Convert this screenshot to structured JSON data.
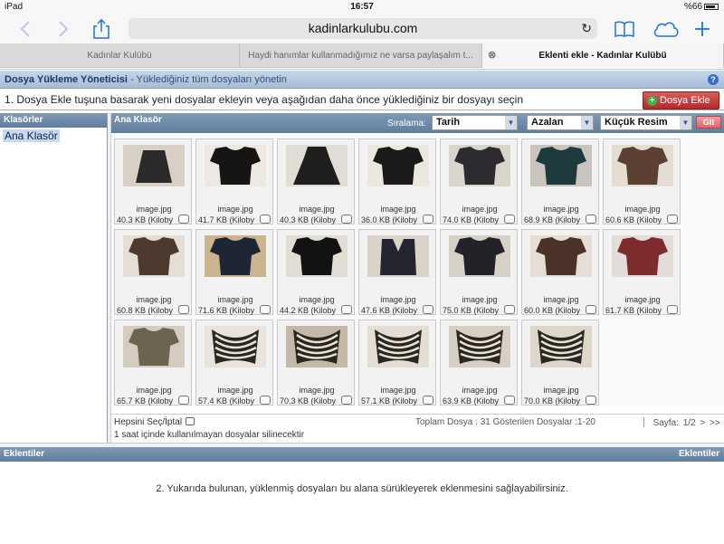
{
  "status": {
    "device": "iPad",
    "time": "16:57",
    "battery": "%66"
  },
  "browser": {
    "url": "kadinlarkulubu.com",
    "tabs": [
      {
        "label": "Kadınlar Kulübü"
      },
      {
        "label": "Haydi hanımlar kullanmadığımız ne varsa paylaşalım t..."
      },
      {
        "label": "Eklenti ekle - Kadınlar Kulübü"
      }
    ]
  },
  "manager": {
    "title": "Dosya Yükleme Yöneticisi",
    "subtitle": "- Yüklediğiniz tüm dosyaları yönetin",
    "help_icon": "?",
    "instruction": "1. Dosya Ekle tuşuna basarak yeni dosyalar ekleyin veya aşağıdan daha önce yüklediğiniz bir dosyayı seçin",
    "add_button": "Dosya Ekle",
    "folders_header": "Klasörler",
    "folder_item": "Ana Klasör",
    "main_header": "Ana Klasör",
    "sort_label": "Sıralama:",
    "sort_field": "Tarih",
    "sort_order": "Azalan",
    "view_mode": "Küçük Resim",
    "go_button": "Git",
    "select_all": "Hepsini Seç/İptal",
    "totals": "Toplam Dosya : 31 Gösterilen Dosyalar :1-20",
    "page": "Sayfa: 1/2",
    "next1": ">",
    "next2": ">>",
    "notice": "1 saat içinde kullanılmayan dosyalar silinecektir",
    "attachments_header": "Eklentiler",
    "attachments_header_right": "Eklentiler",
    "drop_hint": "2. Yukarıda bulunan, yüklenmiş dosyaları bu alana sürükleyerek eklenmesini sağlayabilirsiniz."
  },
  "files": [
    {
      "name": "image.jpg",
      "size": "40.3 KB (Kiloby",
      "color": "#2a2a2a",
      "bg": "#d8d0c4",
      "shape": "skirt"
    },
    {
      "name": "image.jpg",
      "size": "41.7 KB (Kiloby",
      "color": "#151515",
      "bg": "#ede8e2",
      "shape": "top"
    },
    {
      "name": "image.jpg",
      "size": "40.3 KB (Kiloby",
      "color": "#1e1e1e",
      "bg": "#e2ddd4",
      "shape": "dress"
    },
    {
      "name": "image.jpg",
      "size": "36.0 KB (Kiloby",
      "color": "#1a1a1a",
      "bg": "#ece8e0",
      "shape": "top"
    },
    {
      "name": "image.jpg",
      "size": "74.0 KB (Kiloby",
      "color": "#2b2b30",
      "bg": "#d9d4cc",
      "shape": "top"
    },
    {
      "name": "image.jpg",
      "size": "68.9 KB (Kiloby",
      "color": "#1f3a3c",
      "bg": "#c9c5be",
      "shape": "top"
    },
    {
      "name": "image.jpg",
      "size": "60.6 KB (Kiloby",
      "color": "#5b4033",
      "bg": "#e5ddd2",
      "shape": "top"
    },
    {
      "name": "image.jpg",
      "size": "60.8 KB (Kiloby",
      "color": "#4d3a2e",
      "bg": "#e3ded6",
      "shape": "top"
    },
    {
      "name": "image.jpg",
      "size": "71.6 KB (Kiloby",
      "color": "#1e2535",
      "bg": "#cbb58e",
      "shape": "top"
    },
    {
      "name": "image.jpg",
      "size": "44.2 KB (Kiloby",
      "color": "#121212",
      "bg": "#e1dcd4",
      "shape": "top"
    },
    {
      "name": "image.jpg",
      "size": "47.6 KB (Kiloby",
      "color": "#252530",
      "bg": "#d9d3c9",
      "shape": "vest"
    },
    {
      "name": "image.jpg",
      "size": "75.0 KB (Kiloby",
      "color": "#222228",
      "bg": "#d6d0c7",
      "shape": "top"
    },
    {
      "name": "image.jpg",
      "size": "60.0 KB (Kiloby",
      "color": "#4a3229",
      "bg": "#e4ded6",
      "shape": "top"
    },
    {
      "name": "image.jpg",
      "size": "61.7 KB (Kiloby",
      "color": "#7e2b2d",
      "bg": "#e2ddd8",
      "shape": "top"
    },
    {
      "name": "image.jpg",
      "size": "65.7 KB (Kiloby",
      "color": "#6e6250",
      "bg": "#d4ccc0",
      "shape": "top"
    },
    {
      "name": "image.jpg",
      "size": "57.4 KB (Kiloby",
      "color": "#2a2620",
      "bg": "#e8e3dc",
      "shape": "stripe"
    },
    {
      "name": "image.jpg",
      "size": "70.3 KB (Kiloby",
      "color": "#2a2620",
      "bg": "#c4b9a8",
      "shape": "stripe"
    },
    {
      "name": "image.jpg",
      "size": "57.1 KB (Kiloby",
      "color": "#2a2620",
      "bg": "#e3ddd3",
      "shape": "stripe"
    },
    {
      "name": "image.jpg",
      "size": "63.9 KB (Kiloby",
      "color": "#2a2620",
      "bg": "#d7cfc3",
      "shape": "stripe"
    },
    {
      "name": "image.jpg",
      "size": "70.0 KB (Kiloby",
      "color": "#2a2620",
      "bg": "#ddd6cb",
      "shape": "stripe"
    }
  ]
}
